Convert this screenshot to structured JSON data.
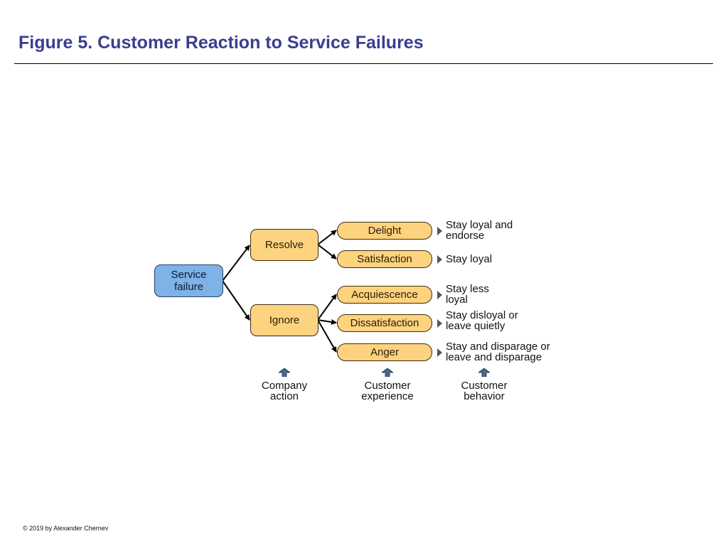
{
  "title": "Figure 5. Customer Reaction to Service Failures",
  "diagram": {
    "root": {
      "label": "Service\nfailure",
      "color": "#7fb2e6"
    },
    "actions": [
      {
        "label": "Resolve",
        "experiences": [
          "Delight",
          "Satisfaction"
        ]
      },
      {
        "label": "Ignore",
        "experiences": [
          "Acquiescence",
          "Dissatisfaction",
          "Anger"
        ]
      }
    ],
    "experiences": [
      {
        "label": "Delight",
        "behavior": "Stay loyal and\nendorse"
      },
      {
        "label": "Satisfaction",
        "behavior": "Stay loyal"
      },
      {
        "label": "Acquiescence",
        "behavior": "Stay less\nloyal"
      },
      {
        "label": "Dissatisfaction",
        "behavior": "Stay disloyal or\nleave quietly"
      },
      {
        "label": "Anger",
        "behavior": "Stay and disparage or\nleave and disparage"
      }
    ],
    "box_fill_color": "#fed37f",
    "column_labels": [
      {
        "label": "Company\naction",
        "icon": "up-arrow-icon"
      },
      {
        "label": "Customer\nexperience",
        "icon": "up-arrow-icon"
      },
      {
        "label": "Customer\nbehavior",
        "icon": "up-arrow-icon"
      }
    ]
  },
  "footer": {
    "copyright": "© 2019 by Alexander Chernev"
  }
}
